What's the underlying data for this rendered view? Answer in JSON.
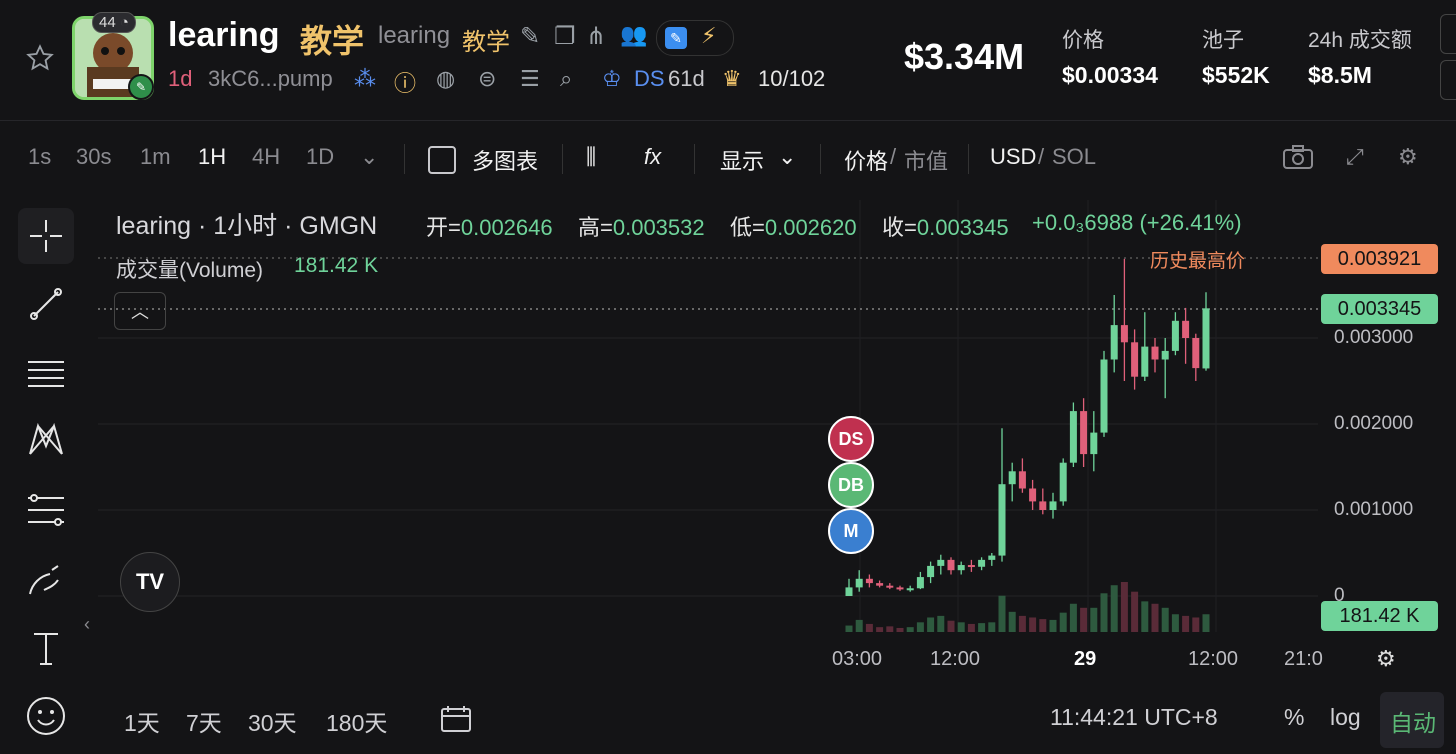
{
  "token": {
    "badge_count": "44",
    "name": "learing",
    "name_cn": "教学",
    "subtitle": "learing",
    "subtitle_cn": "教学",
    "age": "1d",
    "address": "3kC6...pump",
    "ds_label": "DS",
    "ds_age": "61d",
    "holders_rank": "10/102"
  },
  "stats": {
    "market_cap": "$3.34M",
    "price_label": "价格",
    "price_value": "$0.00334",
    "pool_label": "池子",
    "pool_value": "$552K",
    "volume_label": "24h 成交额",
    "volume_value": "$8.5M"
  },
  "toolbar": {
    "intervals": [
      "1s",
      "30s",
      "1m",
      "1H",
      "4H",
      "1D"
    ],
    "selected_interval": "1H",
    "multi_chart": "多图表",
    "display": "显示",
    "price": "价格",
    "mcap": "市值",
    "usd": "USD",
    "sol": "SOL",
    "slash": "/"
  },
  "legend": {
    "title": "learing · 1小时 · GMGN",
    "open_label": "开=",
    "open": "0.002646",
    "high_label": "高=",
    "high": "0.003532",
    "low_label": "低=",
    "low": "0.002620",
    "close_label": "收=",
    "close": "0.003345",
    "change": "+0.0₃6988 (+26.41%)",
    "volume_label": "成交量(Volume)",
    "volume_value": "181.42 K",
    "ath_label": "历史最高价"
  },
  "price_axis": {
    "ath": "0.003921",
    "current": "0.003345",
    "ticks": [
      "0.003000",
      "0.002000",
      "0.001000",
      "0"
    ],
    "volume_box": "181.42 K"
  },
  "time_axis": {
    "ticks": [
      "03:00",
      "12:00",
      "29",
      "12:00",
      "21:0"
    ]
  },
  "markers": [
    "DS",
    "DB",
    "M"
  ],
  "bottom": {
    "ranges": [
      "1天",
      "7天",
      "30天",
      "180天"
    ],
    "clock": "11:44:21 UTC+8",
    "percent": "%",
    "log": "log",
    "auto": "自动"
  },
  "colors": {
    "up": "#6fd39a",
    "down": "#e0607a",
    "ath_box": "#f08a5d",
    "gold": "#f0c36b"
  },
  "chart_data": {
    "type": "candlestick",
    "ylim": [
      0,
      0.0041
    ],
    "x": [
      "28 00:00",
      "28 01:00",
      "28 02:00",
      "28 03:00",
      "28 04:00",
      "28 05:00",
      "28 06:00",
      "28 07:00",
      "28 08:00",
      "28 09:00",
      "28 10:00",
      "28 11:00",
      "28 12:00",
      "28 13:00",
      "28 14:00",
      "28 15:00",
      "28 16:00",
      "28 17:00",
      "28 18:00",
      "28 19:00",
      "28 20:00",
      "28 21:00",
      "28 22:00",
      "28 23:00",
      "29 00:00",
      "29 01:00",
      "29 02:00",
      "29 03:00",
      "29 04:00",
      "29 05:00",
      "29 06:00",
      "29 07:00",
      "29 08:00",
      "29 09:00",
      "29 10:00",
      "29 11:00"
    ],
    "ohlc": [
      [
        0.0,
        0.0002,
        0.0,
        0.0001
      ],
      [
        0.0001,
        0.0003,
        5e-05,
        0.0002
      ],
      [
        0.0002,
        0.00025,
        0.0001,
        0.00015
      ],
      [
        0.00015,
        0.00018,
        0.0001,
        0.00012
      ],
      [
        0.00012,
        0.00015,
        8e-05,
        0.0001
      ],
      [
        0.0001,
        0.00012,
        6e-05,
        8e-05
      ],
      [
        8e-05,
        0.00012,
        5e-05,
        9e-05
      ],
      [
        9e-05,
        0.00028,
        8e-05,
        0.00022
      ],
      [
        0.00022,
        0.0004,
        0.00015,
        0.00035
      ],
      [
        0.00035,
        0.00048,
        0.00025,
        0.00042
      ],
      [
        0.00042,
        0.00045,
        0.00025,
        0.0003
      ],
      [
        0.0003,
        0.0004,
        0.00025,
        0.00036
      ],
      [
        0.00036,
        0.00042,
        0.00028,
        0.00034
      ],
      [
        0.00034,
        0.00045,
        0.0003,
        0.00042
      ],
      [
        0.00042,
        0.0005,
        0.00035,
        0.00047
      ],
      [
        0.00047,
        0.00195,
        0.0004,
        0.0013
      ],
      [
        0.0013,
        0.00155,
        0.0011,
        0.00145
      ],
      [
        0.00145,
        0.0016,
        0.0012,
        0.00125
      ],
      [
        0.00125,
        0.00135,
        0.001,
        0.0011
      ],
      [
        0.0011,
        0.00125,
        0.00095,
        0.001
      ],
      [
        0.001,
        0.0012,
        0.0009,
        0.0011
      ],
      [
        0.0011,
        0.0016,
        0.00105,
        0.00155
      ],
      [
        0.00155,
        0.00225,
        0.0015,
        0.00215
      ],
      [
        0.00215,
        0.0023,
        0.0015,
        0.00165
      ],
      [
        0.00165,
        0.00215,
        0.00145,
        0.0019
      ],
      [
        0.0019,
        0.00285,
        0.00185,
        0.00275
      ],
      [
        0.00275,
        0.0035,
        0.0026,
        0.00315
      ],
      [
        0.00315,
        0.00392,
        0.0025,
        0.00295
      ],
      [
        0.00295,
        0.0031,
        0.0024,
        0.00255
      ],
      [
        0.00255,
        0.0033,
        0.0025,
        0.0029
      ],
      [
        0.0029,
        0.003,
        0.0026,
        0.00275
      ],
      [
        0.00275,
        0.003,
        0.0023,
        0.00285
      ],
      [
        0.00285,
        0.0033,
        0.0028,
        0.0032
      ],
      [
        0.0032,
        0.00335,
        0.0027,
        0.003
      ],
      [
        0.003,
        0.00305,
        0.0025,
        0.00265
      ],
      [
        0.002646,
        0.003532,
        0.00262,
        0.003345
      ]
    ],
    "volume": [
      8,
      15,
      10,
      6,
      7,
      5,
      6,
      12,
      18,
      20,
      14,
      12,
      10,
      11,
      12,
      45,
      25,
      20,
      18,
      16,
      15,
      24,
      35,
      30,
      30,
      48,
      58,
      62,
      50,
      38,
      35,
      30,
      22,
      20,
      18,
      22
    ]
  }
}
